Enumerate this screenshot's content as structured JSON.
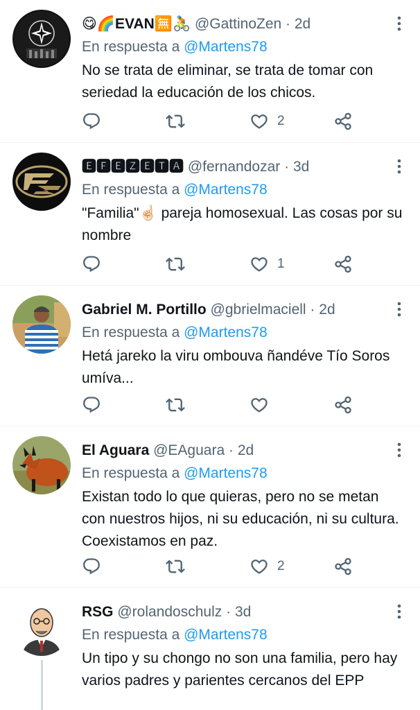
{
  "reply_prefix": "En respuesta a",
  "tweets": [
    {
      "name": "😋🌈EVAN🈚🚴",
      "handle": "@GattinoZen",
      "separator": "·",
      "time": "2d",
      "reply_to": "@Martens78",
      "text": "No se trata de eliminar, se trata de tomar con seriedad la educación de los chicos.",
      "reply_count": "",
      "retweet_count": "",
      "like_count": "2",
      "avatar_icon": "star-logo"
    },
    {
      "name": "🅴🅵🅴🆉🅴🆃🅰",
      "handle": "@fernandozar",
      "separator": "·",
      "time": "3d",
      "reply_to": "@Martens78",
      "text": "\"Familia\"☝🏻 pareja homosexual. Las cosas por su nombre",
      "reply_count": "",
      "retweet_count": "",
      "like_count": "1",
      "avatar_icon": "fz-logo"
    },
    {
      "name": "Gabriel M. Portillo",
      "handle": "@gbrielmaciell",
      "separator": "·",
      "time": "2d",
      "reply_to": "@Martens78",
      "text": "Hetá jareko la viru ombouva ñandéve Tío Soros umíva...",
      "reply_count": "",
      "retweet_count": "",
      "like_count": "",
      "avatar_icon": "person-photo"
    },
    {
      "name": "El Aguara",
      "handle": "@EAguara",
      "separator": "·",
      "time": "2d",
      "reply_to": "@Martens78",
      "text": "Existan todo lo que quieras, pero no se metan con nuestros hijos, ni su educación, ni su cultura. Coexistamos en paz.",
      "reply_count": "",
      "retweet_count": "",
      "like_count": "2",
      "avatar_icon": "maned-wolf-photo"
    },
    {
      "name": "RSG",
      "handle": "@rolandoschulz",
      "separator": "·",
      "time": "3d",
      "reply_to": "@Martens78",
      "text": "Un tipo y su chongo no son una familia, pero hay varios padres y parientes cercanos del EPP",
      "reply_count": "",
      "retweet_count": "",
      "like_count": "",
      "avatar_icon": "cartoon-man"
    }
  ],
  "colors": {
    "text": "#0f1419",
    "secondary": "#536471",
    "link": "#1d9bf0",
    "divider": "#eff3f4"
  }
}
